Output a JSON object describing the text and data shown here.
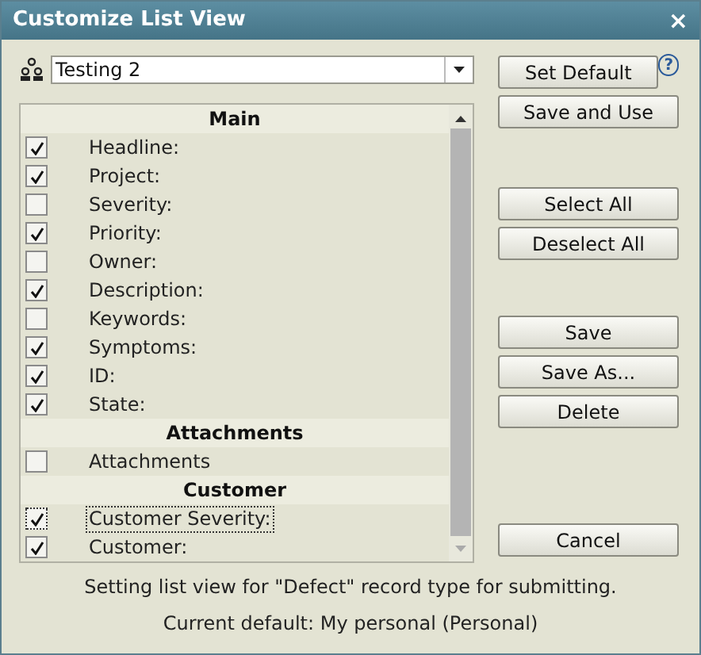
{
  "window": {
    "title": "Customize List View",
    "close": "×"
  },
  "view_select": {
    "value": "Testing 2"
  },
  "set_default": "Set Default",
  "help": "?",
  "list": [
    {
      "kind": "header",
      "label": "Main"
    },
    {
      "kind": "field",
      "label": "Headline:",
      "checked": true,
      "focused": false
    },
    {
      "kind": "field",
      "label": "Project:",
      "checked": true,
      "focused": false
    },
    {
      "kind": "field",
      "label": "Severity:",
      "checked": false,
      "focused": false
    },
    {
      "kind": "field",
      "label": "Priority:",
      "checked": true,
      "focused": false
    },
    {
      "kind": "field",
      "label": "Owner:",
      "checked": false,
      "focused": false
    },
    {
      "kind": "field",
      "label": "Description:",
      "checked": true,
      "focused": false
    },
    {
      "kind": "field",
      "label": "Keywords:",
      "checked": false,
      "focused": false
    },
    {
      "kind": "field",
      "label": "Symptoms:",
      "checked": true,
      "focused": false
    },
    {
      "kind": "field",
      "label": "ID:",
      "checked": true,
      "focused": false
    },
    {
      "kind": "field",
      "label": "State:",
      "checked": true,
      "focused": false
    },
    {
      "kind": "header",
      "label": "Attachments"
    },
    {
      "kind": "field",
      "label": "Attachments",
      "checked": false,
      "focused": false
    },
    {
      "kind": "header",
      "label": "Customer"
    },
    {
      "kind": "field",
      "label": "Customer Severity:",
      "checked": true,
      "focused": true
    },
    {
      "kind": "field",
      "label": "Customer:",
      "checked": true,
      "focused": false
    }
  ],
  "button_groups": [
    [
      "Save and Use"
    ],
    [
      "Select All",
      "Deselect All"
    ],
    [
      "Save",
      "Save As...",
      "Delete"
    ],
    [
      "Cancel"
    ]
  ],
  "status": "Setting list view for \"Defect\" record type for submitting.",
  "current_default": "Current default: My personal (Personal)"
}
